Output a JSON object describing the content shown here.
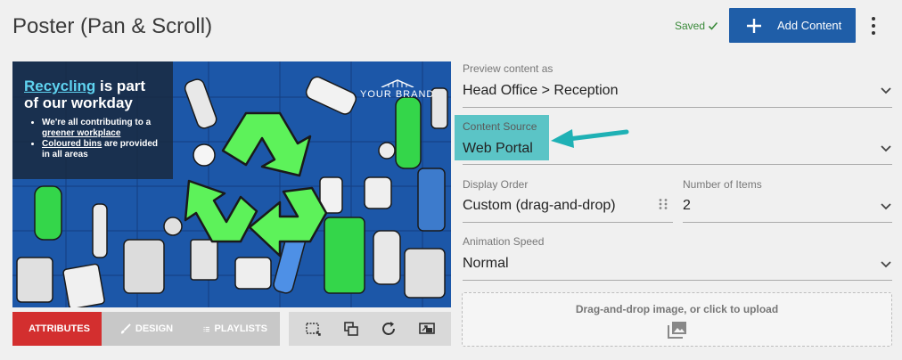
{
  "header": {
    "title": "Poster (Pan & Scroll)",
    "saved_label": "Saved",
    "add_label": "Add Content"
  },
  "poster": {
    "headline_highlight": "Recycling",
    "headline_rest": " is part of our workday",
    "bullet1_text": "We're all contributing to a ",
    "bullet1_link": "greener workplace",
    "bullet2_link": "Coloured bins",
    "bullet2_text": " are provided in all areas",
    "brand": "YOUR BRAND"
  },
  "tabs": {
    "attributes": "ATTRIBUTES",
    "design": "DESIGN",
    "playlists": "PLAYLISTS"
  },
  "form": {
    "preview_label": "Preview content as",
    "preview_value": "Head Office > Reception",
    "source_label": "Content Source",
    "source_value": "Web Portal",
    "order_label": "Display Order",
    "order_value": "Custom (drag-and-drop)",
    "items_label": "Number of Items",
    "items_value": "2",
    "speed_label": "Animation Speed",
    "speed_value": "Normal",
    "upload_text": "Drag-and-drop image, or click to upload"
  },
  "colors": {
    "primary": "#1f5ea8",
    "danger": "#d32f2f",
    "highlight": "#5bc4c6",
    "arrow": "#1fb1b5",
    "success": "#3a8a3a"
  }
}
